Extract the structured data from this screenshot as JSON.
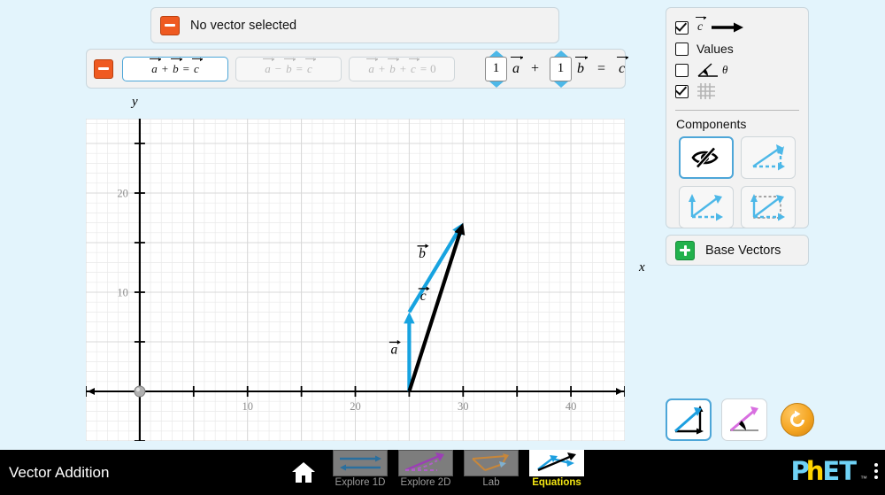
{
  "sim": {
    "title": "Vector Addition",
    "background_color": "#e3f4fc",
    "accent_color": "#4da6d8"
  },
  "status_bar": {
    "collapse_icon": "minus-icon",
    "text": "No vector selected"
  },
  "equation_toolbar": {
    "collapse_icon": "minus-icon",
    "equation_buttons": [
      {
        "id": "a-plus-b",
        "parts": [
          "a",
          "+",
          "b",
          "=",
          "c"
        ],
        "selected": true
      },
      {
        "id": "a-minus-b",
        "parts": [
          "a",
          "−",
          "b",
          "=",
          "c"
        ],
        "selected": false
      },
      {
        "id": "a-plus-b-plus-c",
        "parts": [
          "a",
          "+",
          "b",
          "+",
          "c",
          "=",
          "0"
        ],
        "selected": false
      }
    ],
    "coefficient_a": "1",
    "coefficient_b": "1",
    "symbol_a": "a",
    "symbol_b": "b",
    "symbol_c": "c",
    "plus": "+",
    "equals": "="
  },
  "control_panel": {
    "checkboxes": [
      {
        "id": "sum-vector",
        "label": "",
        "icon": "vector-c-arrow-icon",
        "symbol": "c",
        "checked": true
      },
      {
        "id": "values",
        "label": "Values",
        "icon": "",
        "symbol": "",
        "checked": false
      },
      {
        "id": "angles",
        "label": "",
        "icon": "angle-theta-icon",
        "symbol": "θ",
        "checked": false
      },
      {
        "id": "grid",
        "label": "",
        "icon": "grid-icon",
        "symbol": "",
        "checked": true
      }
    ],
    "components_title": "Components",
    "component_buttons": [
      {
        "id": "invisible",
        "icon": "eye-off-icon",
        "selected": true
      },
      {
        "id": "triangle",
        "icon": "triangle-components-icon",
        "selected": false
      },
      {
        "id": "parallelogram",
        "icon": "parallelogram-components-icon",
        "selected": false
      },
      {
        "id": "projection",
        "icon": "projection-components-icon",
        "selected": false
      }
    ]
  },
  "base_vectors": {
    "expand_icon": "plus-icon",
    "label": "Base Vectors"
  },
  "scene_controls": {
    "buttons": [
      {
        "id": "cartesian",
        "icon": "cartesian-vector-icon",
        "selected": true
      },
      {
        "id": "polar",
        "icon": "polar-vector-icon",
        "selected": false
      }
    ],
    "reset_icon": "reset-all-icon"
  },
  "navbar": {
    "home_icon": "home-icon",
    "tabs": [
      {
        "id": "explore-1d",
        "label": "Explore 1D",
        "active": false
      },
      {
        "id": "explore-2d",
        "label": "Explore 2D",
        "active": false
      },
      {
        "id": "lab",
        "label": "Lab",
        "active": false
      },
      {
        "id": "equations",
        "label": "Equations",
        "active": true
      }
    ],
    "logo": {
      "p": "P",
      "h": "h",
      "et": "ET",
      "tm": "™"
    },
    "menu_icon": "kebab-menu-icon"
  },
  "chart_data": {
    "type": "scatter",
    "title": "",
    "xlabel": "x",
    "ylabel": "y",
    "xlim": [
      -5,
      45
    ],
    "ylim": [
      -5,
      27.5
    ],
    "xticks": [
      10,
      20,
      30,
      40
    ],
    "yticks": [
      10,
      20
    ],
    "tick_interval": 5,
    "grid": true,
    "grid_minor_interval": 1,
    "origin_marker": true,
    "vectors": [
      {
        "name": "a",
        "label": "a",
        "tail": [
          25,
          0
        ],
        "tip": [
          25,
          8
        ],
        "components": [
          0,
          8
        ],
        "color": "#17a3e0",
        "label_pos": [
          23.6,
          3.8
        ]
      },
      {
        "name": "b",
        "label": "b",
        "tail": [
          25,
          8
        ],
        "tip": [
          30,
          17
        ],
        "components": [
          5,
          9
        ],
        "color": "#17a3e0",
        "label_pos": [
          26.2,
          13.5
        ]
      },
      {
        "name": "c",
        "label": "c",
        "tail": [
          25,
          0
        ],
        "tip": [
          30,
          17
        ],
        "components": [
          5,
          17
        ],
        "color": "#000000",
        "label_pos": [
          26.3,
          9.2
        ]
      }
    ]
  }
}
